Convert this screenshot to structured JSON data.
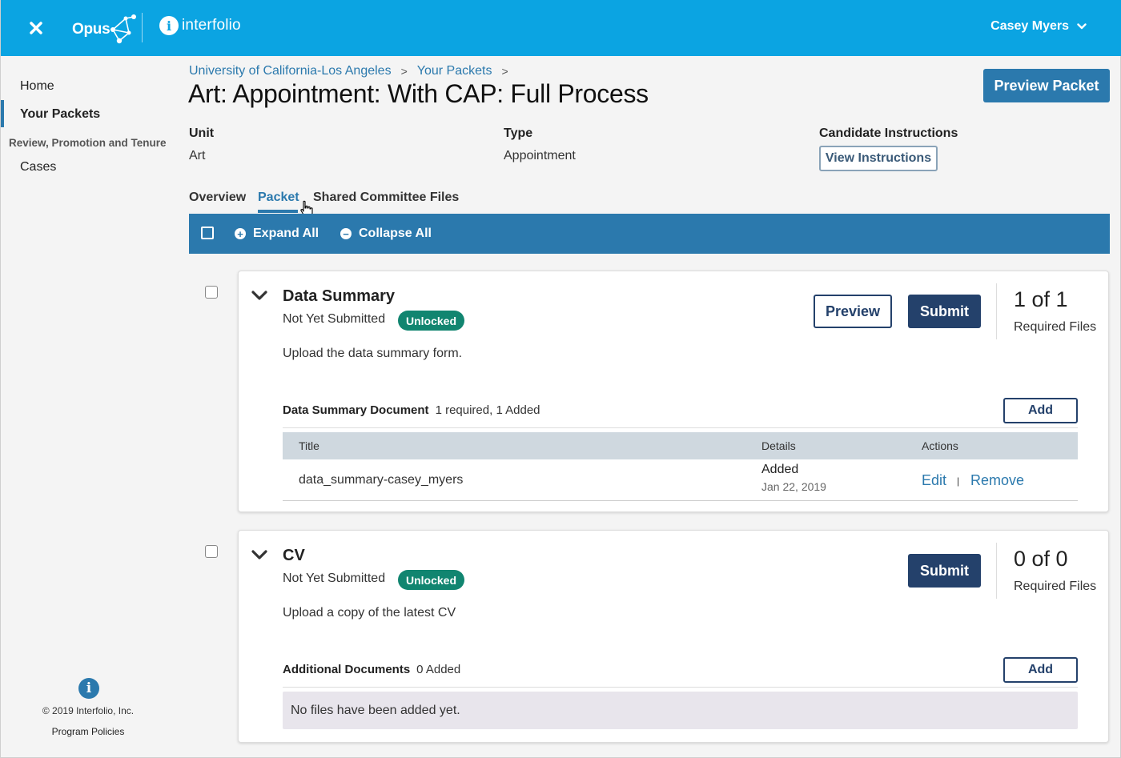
{
  "topbar": {
    "opus_label": "Opus",
    "interfolio_label": "interfolio",
    "interfolio_mark": "i",
    "user_name": "Casey Myers",
    "bg_color": "#0ba4e2"
  },
  "sidebar": {
    "items": [
      {
        "label": "Home"
      },
      {
        "label": "Your Packets"
      }
    ],
    "section_label": "Review, Promotion and Tenure",
    "section_items": [
      {
        "label": "Cases"
      }
    ],
    "footer_mark": "i",
    "copyright": "© 2019 Interfolio, Inc.",
    "policies": "Program Policies"
  },
  "breadcrumb": {
    "items": [
      "University of California-Los Angeles",
      "Your Packets"
    ],
    "separator": ">"
  },
  "page": {
    "title": "Art: Appointment: With CAP: Full Process",
    "preview_packet": "Preview Packet",
    "unit_label": "Unit",
    "unit_value": "Art",
    "type_label": "Type",
    "type_value": "Appointment",
    "instructions_label": "Candidate Instructions",
    "view_instructions": "View Instructions"
  },
  "tabs": [
    {
      "label": "Overview"
    },
    {
      "label": "Packet"
    },
    {
      "label": "Shared Committee Files"
    }
  ],
  "action_bar": {
    "expand_all": "Expand All",
    "collapse_all": "Collapse All",
    "plus": "+",
    "minus": "−"
  },
  "sections": [
    {
      "title": "Data Summary",
      "status": "Not Yet Submitted",
      "badge": "Unlocked",
      "description": "Upload the data summary form.",
      "preview_label": "Preview",
      "submit_label": "Submit",
      "required_count": "1 of 1",
      "required_label": "Required Files",
      "doc_title": "Data Summary Document",
      "doc_info": "1 required, 1 Added",
      "add_label": "Add",
      "table_headers": [
        "Title",
        "Details",
        "Actions"
      ],
      "rows": [
        {
          "title": "data_summary-casey_myers",
          "detail": "Added",
          "date": "Jan 22, 2019",
          "edit": "Edit",
          "separator": "|",
          "remove": "Remove"
        }
      ]
    },
    {
      "title": "CV",
      "status": "Not Yet Submitted",
      "badge": "Unlocked",
      "description": "Upload a copy of the latest CV",
      "submit_label": "Submit",
      "required_count": "0 of 0",
      "required_label": "Required Files",
      "doc_title": "Additional Documents",
      "doc_info": "0 Added",
      "add_label": "Add",
      "empty_message": "No files have been added yet."
    }
  ]
}
